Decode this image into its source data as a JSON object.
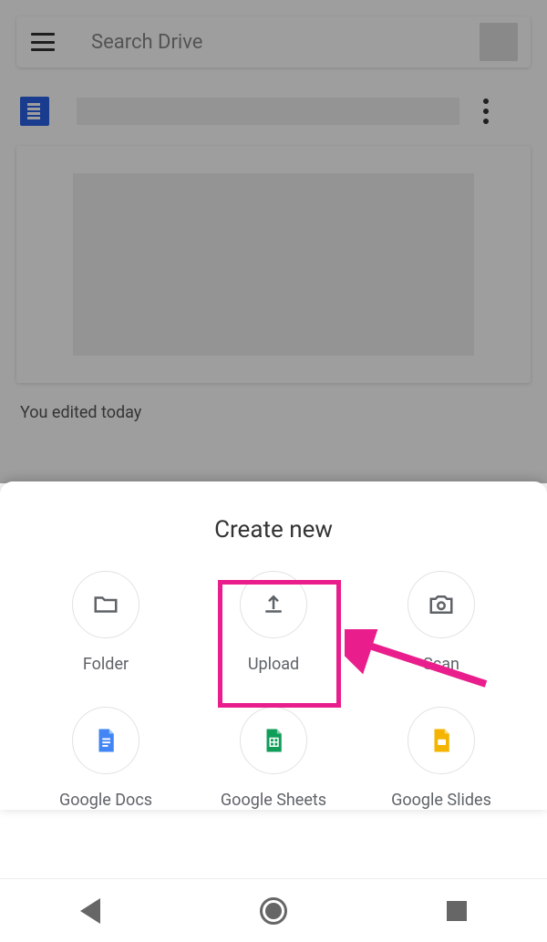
{
  "search": {
    "placeholder": "Search Drive"
  },
  "file": {
    "edited_status": "You edited today"
  },
  "sheet": {
    "title": "Create new",
    "options": [
      {
        "label": "Folder"
      },
      {
        "label": "Upload"
      },
      {
        "label": "Scan"
      },
      {
        "label": "Google Docs"
      },
      {
        "label": "Google Sheets"
      },
      {
        "label": "Google Slides"
      }
    ]
  },
  "annotation": {
    "highlight_color": "#e91e8c"
  }
}
